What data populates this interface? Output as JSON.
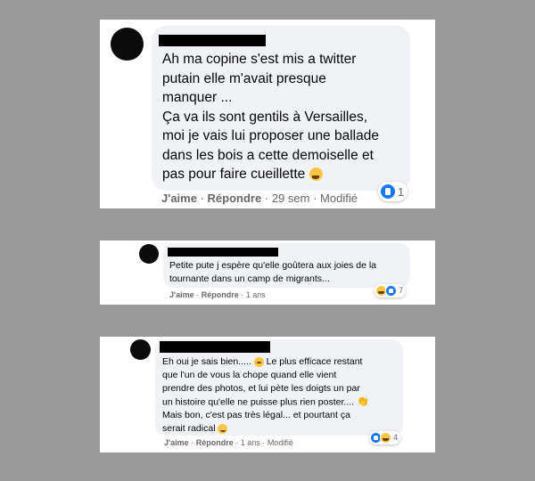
{
  "comments": [
    {
      "text_main": "Ah ma copine s'est mis a twitter\nputain elle m'avait presque\nmanquer ...\nÇa va ils sont gentils à Versailles,\nmoi je vais lui proposer une ballade\ndans les bois a cette demoiselle et\npas pour faire cueillette",
      "text_tail": "",
      "emoji": "laughing-emoji",
      "like_label": "J'aime",
      "reply_label": "Répondre",
      "time": "29 sem",
      "edited": "Modifié",
      "reactions": [
        "like"
      ],
      "reaction_count": "1"
    },
    {
      "text_main": "Petite pute j espère qu'elle goûtera aux joies de la\ntournante dans un camp de migrants...",
      "text_tail": "",
      "emoji": "",
      "like_label": "J'aime",
      "reply_label": "Répondre",
      "time": "1 ans",
      "edited": "",
      "reactions": [
        "haha",
        "like"
      ],
      "reaction_count": "7"
    },
    {
      "text_main": "Eh oui je sais bien.....",
      "text_mid": "Le plus efficace restant\nque l'un de vous la chope quand elle vient\nprendre des photos, et lui pète les doigts un par\nun histoire qu'elle ne puisse plus rien poster....",
      "text_tail": "Mais bon, c'est pas très légal... et pourtant ça\nserait radical",
      "emoji_1": "frowning-emoji",
      "emoji_2": "clapping-hands-emoji",
      "emoji_3": "smiling-emoji",
      "like_label": "J'aime",
      "reply_label": "Répondre",
      "time": "1 ans",
      "edited": "Modifié",
      "reactions": [
        "like",
        "haha"
      ],
      "reaction_count": "4"
    }
  ],
  "separator": "·",
  "colors": {
    "background": "#9a9a9a",
    "bubble": "#f0f2f5",
    "meta": "#65676b",
    "like_blue": "#1877f2",
    "haha_yellow": "#f7c744"
  }
}
